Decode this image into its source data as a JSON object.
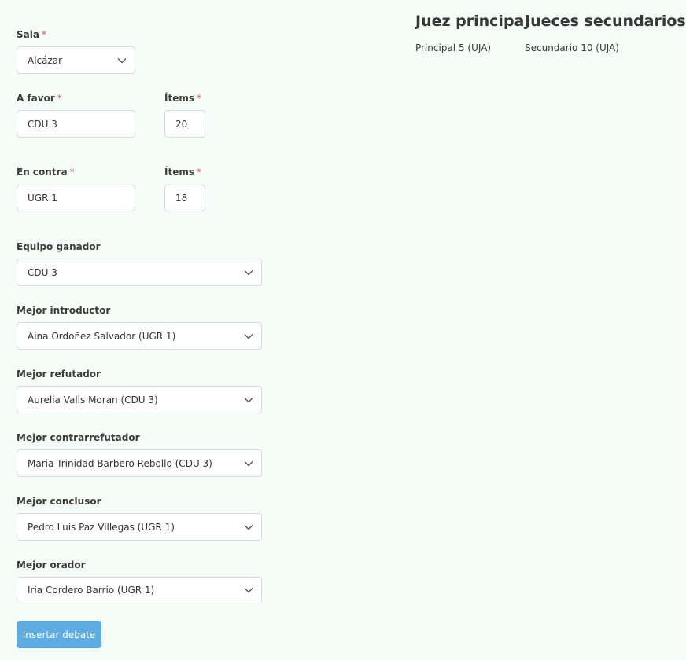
{
  "form": {
    "sala": {
      "label": "Sala",
      "value": "Alcázar"
    },
    "a_favor": {
      "label": "A favor",
      "value": "CDU 3"
    },
    "a_favor_items": {
      "label": "Ítems",
      "value": "20"
    },
    "en_contra": {
      "label": "En contra",
      "value": "UGR 1"
    },
    "en_contra_items": {
      "label": "Ítems",
      "value": "18"
    },
    "required_mark": "*",
    "equipo_ganador": {
      "label": "Equipo ganador",
      "value": "CDU 3"
    },
    "mejor_introductor": {
      "label": "Mejor introductor",
      "value": "Aina Ordoñez Salvador (UGR 1)"
    },
    "mejor_refutador": {
      "label": "Mejor refutador",
      "value": "Aurelia Valls Moran (CDU 3)"
    },
    "mejor_contrarrefutador": {
      "label": "Mejor contrarrefutador",
      "value": "Maria Trinidad Barbero Rebollo (CDU 3)"
    },
    "mejor_conclusor": {
      "label": "Mejor conclusor",
      "value": "Pedro Luis Paz Villegas (UGR 1)"
    },
    "mejor_orador": {
      "label": "Mejor orador",
      "value": "Iria Cordero Barrio (UGR 1)"
    },
    "submit_label": "Insertar debate"
  },
  "judges": {
    "principal_title": "Juez principal",
    "principal_name": "Principal 5 (UJA)",
    "secundarios_title": "Jueces secundarios",
    "secundarios_name": "Secundario 10 (UJA)"
  },
  "icons": {
    "dropdown": "chevron-down-icon"
  },
  "colors": {
    "background": "#f5fdf9",
    "required": "#e0474f",
    "button": "#5dade2"
  }
}
